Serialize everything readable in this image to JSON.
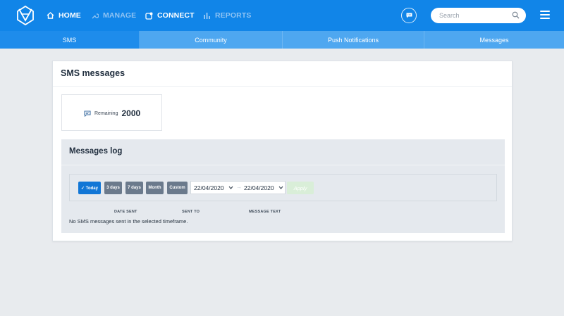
{
  "nav": {
    "items": [
      {
        "label": "HOME",
        "icon": "home-icon",
        "active": true
      },
      {
        "label": "MANAGE",
        "icon": "wrench-icon",
        "active": false
      },
      {
        "label": "CONNECT",
        "icon": "connect-icon",
        "active": true
      },
      {
        "label": "REPORTS",
        "icon": "bar-chart-icon",
        "active": false
      }
    ],
    "search_placeholder": "Search",
    "icons": [
      "logo-icon",
      "chat-bubble-icon",
      "search-icon",
      "hamburger-menu-icon"
    ]
  },
  "tabs": [
    {
      "label": "SMS",
      "active": true
    },
    {
      "label": "Community",
      "active": false
    },
    {
      "label": "Push Notifications",
      "active": false
    },
    {
      "label": "Messages",
      "active": false
    }
  ],
  "sms": {
    "title": "SMS messages",
    "remaining_label": "Remaining",
    "remaining_value": "2000"
  },
  "log": {
    "title": "Messages log",
    "filters": [
      {
        "label": "✓ Today",
        "active": true
      },
      {
        "label": "3 days",
        "active": false
      },
      {
        "label": "7 days",
        "active": false
      },
      {
        "label": "Month",
        "active": false
      },
      {
        "label": "Custom",
        "active": false
      }
    ],
    "date_from": "22/04/2020",
    "date_to": "22/04/2020",
    "arrow": "→",
    "apply_label": "Apply",
    "columns": [
      "DATE SENT",
      "SENT TO",
      "MESSAGE TEXT"
    ],
    "empty_message": "No SMS messages sent in the selected timeframe."
  },
  "colors": {
    "topbar": "#1185e8",
    "subnav": "#4ea7f0",
    "active_tab": "#1e8ceb",
    "today_button": "#1176d6",
    "filter_button": "#6b7a8c",
    "apply_button": "#d9eed8",
    "background": "#e8ebee"
  }
}
